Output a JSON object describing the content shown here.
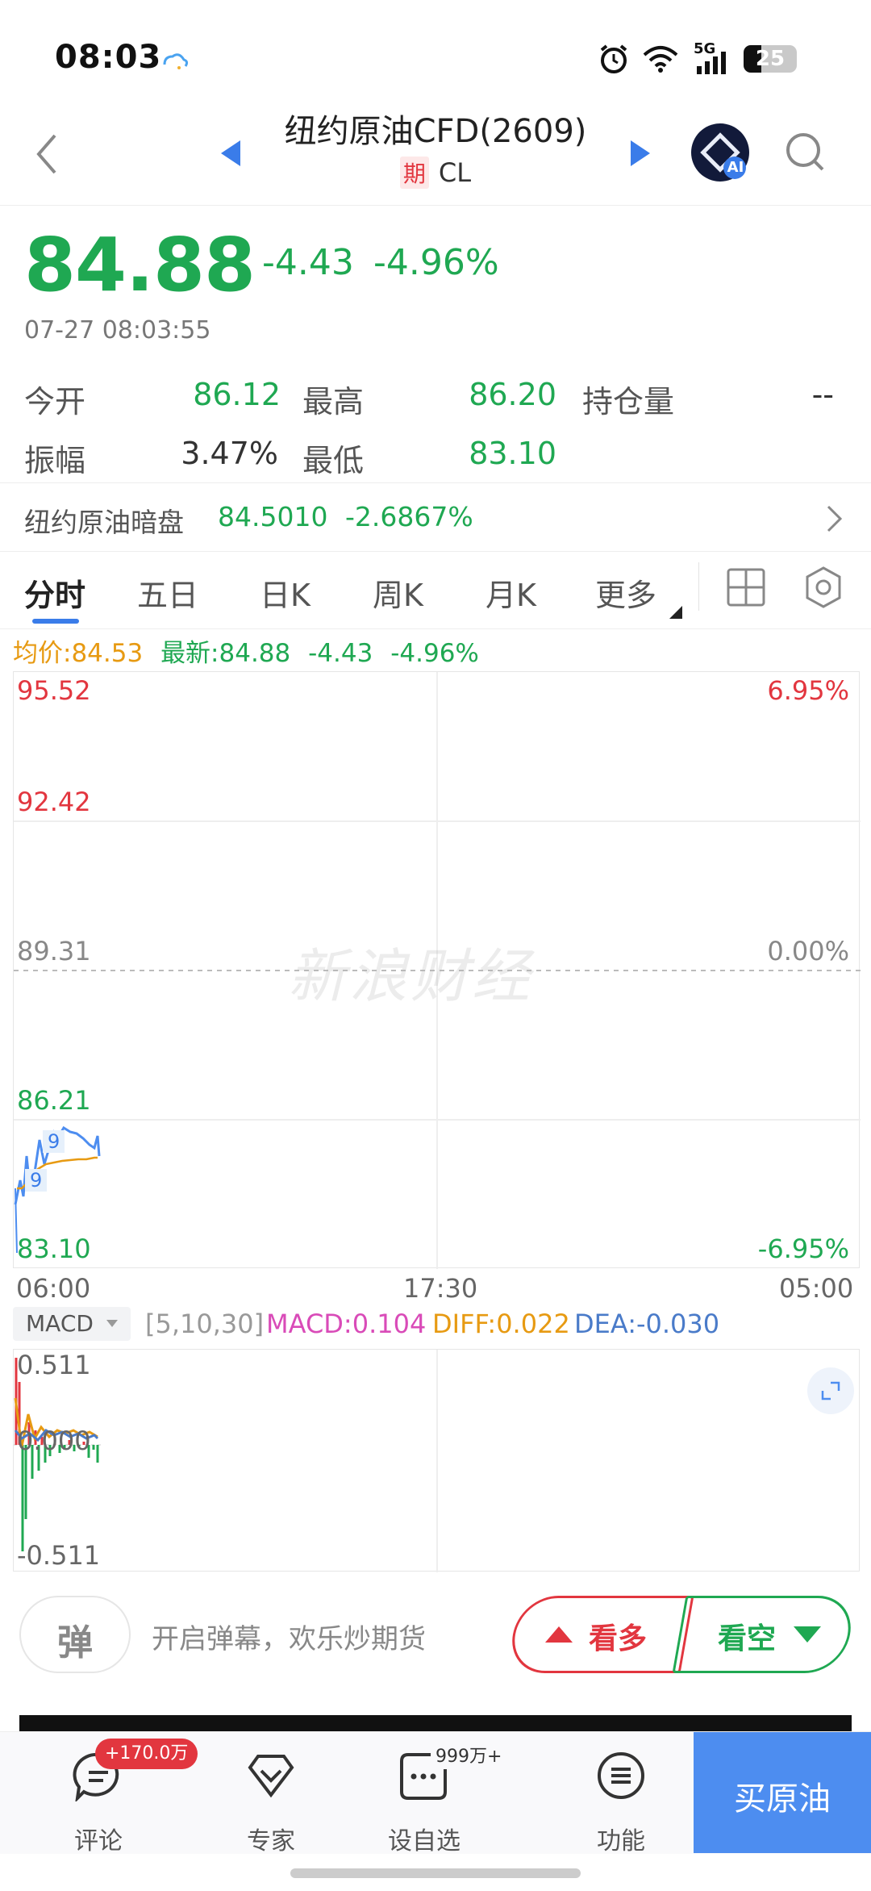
{
  "status_bar": {
    "time": "08:03",
    "battery": "25",
    "network": "5G"
  },
  "header": {
    "title": "纽约原油CFD(2609)",
    "badge": "期",
    "code": "CL",
    "ai_label": "AI"
  },
  "quote": {
    "price": "84.88",
    "change": "-4.43",
    "change_pct": "-4.96%",
    "timestamp": "07-27 08:03:55",
    "open_label": "今开",
    "open": "86.12",
    "high_label": "最高",
    "high": "86.20",
    "oi_label": "持仓量",
    "oi": "--",
    "amp_label": "振幅",
    "amp": "3.47%",
    "low_label": "最低",
    "low": "83.10"
  },
  "dark_pool": {
    "label": "纽约原油暗盘",
    "value": "84.5010",
    "change": "-2.6867%"
  },
  "tabs": [
    {
      "label": "分时"
    },
    {
      "label": "五日"
    },
    {
      "label": "日K"
    },
    {
      "label": "周K"
    },
    {
      "label": "月K"
    },
    {
      "label": "更多"
    }
  ],
  "chart_info": {
    "avg": "均价:84.53",
    "latest": "最新:84.88",
    "change": "-4.43",
    "pct": "-4.96%"
  },
  "chart": {
    "y_left": [
      "95.52",
      "92.42",
      "89.31",
      "86.21",
      "83.10"
    ],
    "y_right": [
      "6.95%",
      "0.00%",
      "-6.95%"
    ],
    "x": [
      "06:00",
      "17:30",
      "05:00"
    ],
    "watermark": "新浪财经",
    "marker": "9"
  },
  "macd": {
    "selector": "MACD",
    "params": "[5,10,30]",
    "macd": "MACD:0.104",
    "diff": "DIFF:0.022",
    "dea": "DEA:-0.030",
    "y": [
      "0.511",
      "0.000",
      "-0.511"
    ]
  },
  "barrage": {
    "icon_text": "弹",
    "placeholder": "开启弹幕，欢乐炒期货",
    "bull": "看多",
    "bear": "看空"
  },
  "nav": {
    "comment": "评论",
    "comment_badge": "+170.0万",
    "expert": "专家",
    "watch": "设自选",
    "watch_badge": "999万+",
    "func": "功能",
    "buy": "买原油"
  },
  "colors": {
    "up": "#e2363f",
    "down": "#1fa852",
    "accent": "#3a7ce9",
    "avg": "#e79a12",
    "buy_bg": "#4d8df0"
  }
}
